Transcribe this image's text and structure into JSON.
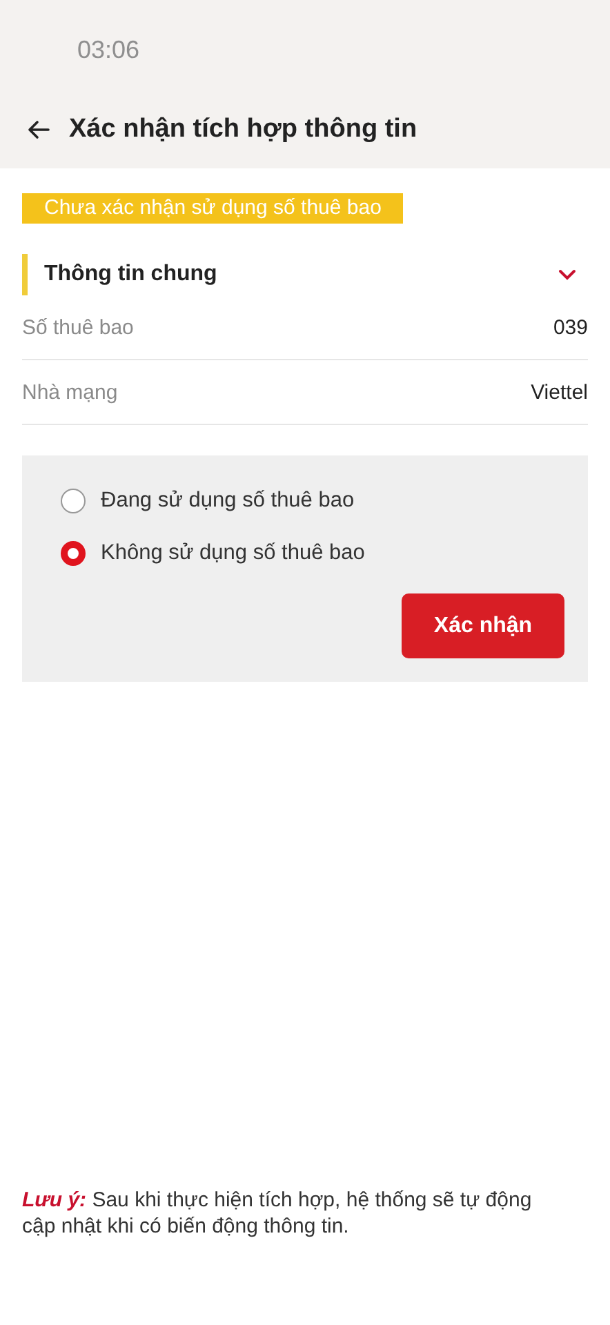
{
  "status_bar": {
    "time": "03:06"
  },
  "header": {
    "title": "Xác nhận tích hợp thông tin"
  },
  "status_badge": "Chưa xác nhận sử dụng số thuê bao",
  "section": {
    "title": "Thông tin chung",
    "expanded": true,
    "rows": [
      {
        "label": "Số thuê bao",
        "value": "039"
      },
      {
        "label": "Nhà mạng",
        "value": "Viettel"
      }
    ]
  },
  "options": [
    {
      "label": "Đang sử dụng số thuê bao",
      "selected": false
    },
    {
      "label": "Không sử dụng số thuê bao",
      "selected": true
    }
  ],
  "confirm_button": "Xác nhận",
  "note": "**Lưu ý:** Sau khi thực hiện tích hợp, hệ thống sẽ tự động cập nhật khi có biến động thông tin."
}
